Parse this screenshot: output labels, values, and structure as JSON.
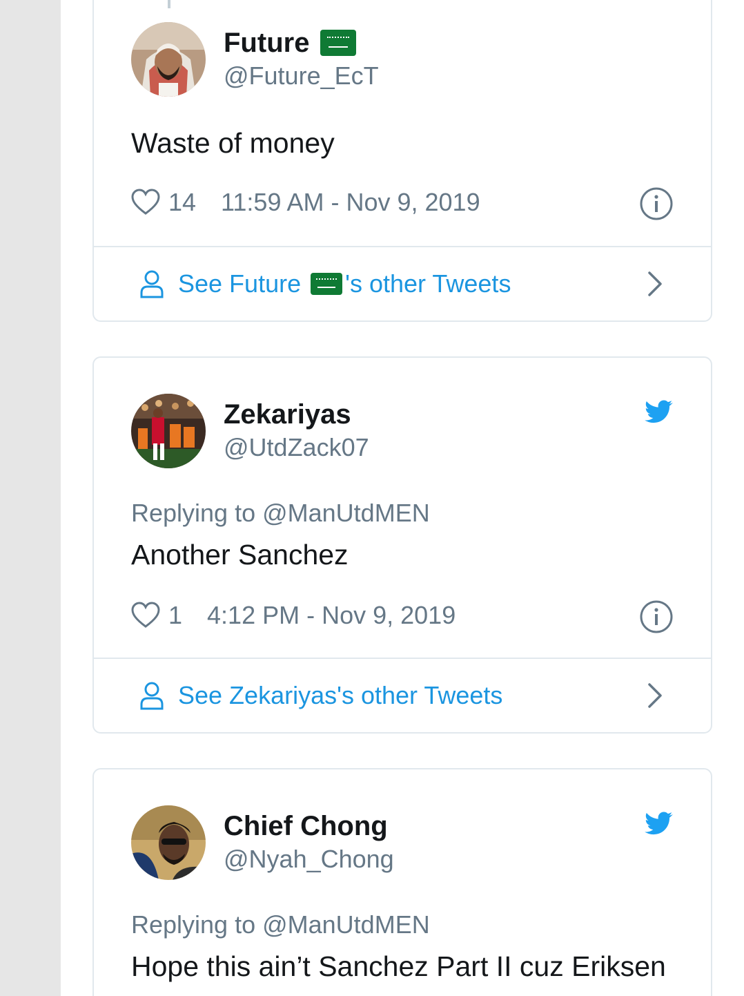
{
  "tweets": [
    {
      "display_name": "Future",
      "handle": "@Future_EcT",
      "has_flag": true,
      "text": "Waste of money",
      "likes": "14",
      "timestamp": "11:59 AM - Nov 9, 2019",
      "other_tweets_prefix": "See Future",
      "other_tweets_suffix": "'s other Tweets"
    },
    {
      "display_name": "Zekariyas",
      "handle": "@UtdZack07",
      "replying_to": "Replying to @ManUtdMEN",
      "text": "Another Sanchez",
      "likes": "1",
      "timestamp": "4:12 PM - Nov 9, 2019",
      "other_tweets": "See Zekariyas's other Tweets"
    },
    {
      "display_name": "Chief Chong",
      "handle": "@Nyah_Chong",
      "replying_to": "Replying to @ManUtdMEN",
      "text": "Hope this ain’t Sanchez Part II cuz Eriksen"
    }
  ],
  "icons": {
    "like": "heart-outline-icon",
    "info": "info-circle-icon",
    "profile": "person-outline-icon",
    "chevron": "chevron-right-icon",
    "twitter": "twitter-bird-icon",
    "flag": "saudi-flag-emoji"
  },
  "colors": {
    "link_blue": "#1b95e0",
    "twitter_blue": "#1da1f2",
    "muted_gray": "#657786",
    "border": "#e1e8ed",
    "flag_green": "#0f7a34"
  }
}
